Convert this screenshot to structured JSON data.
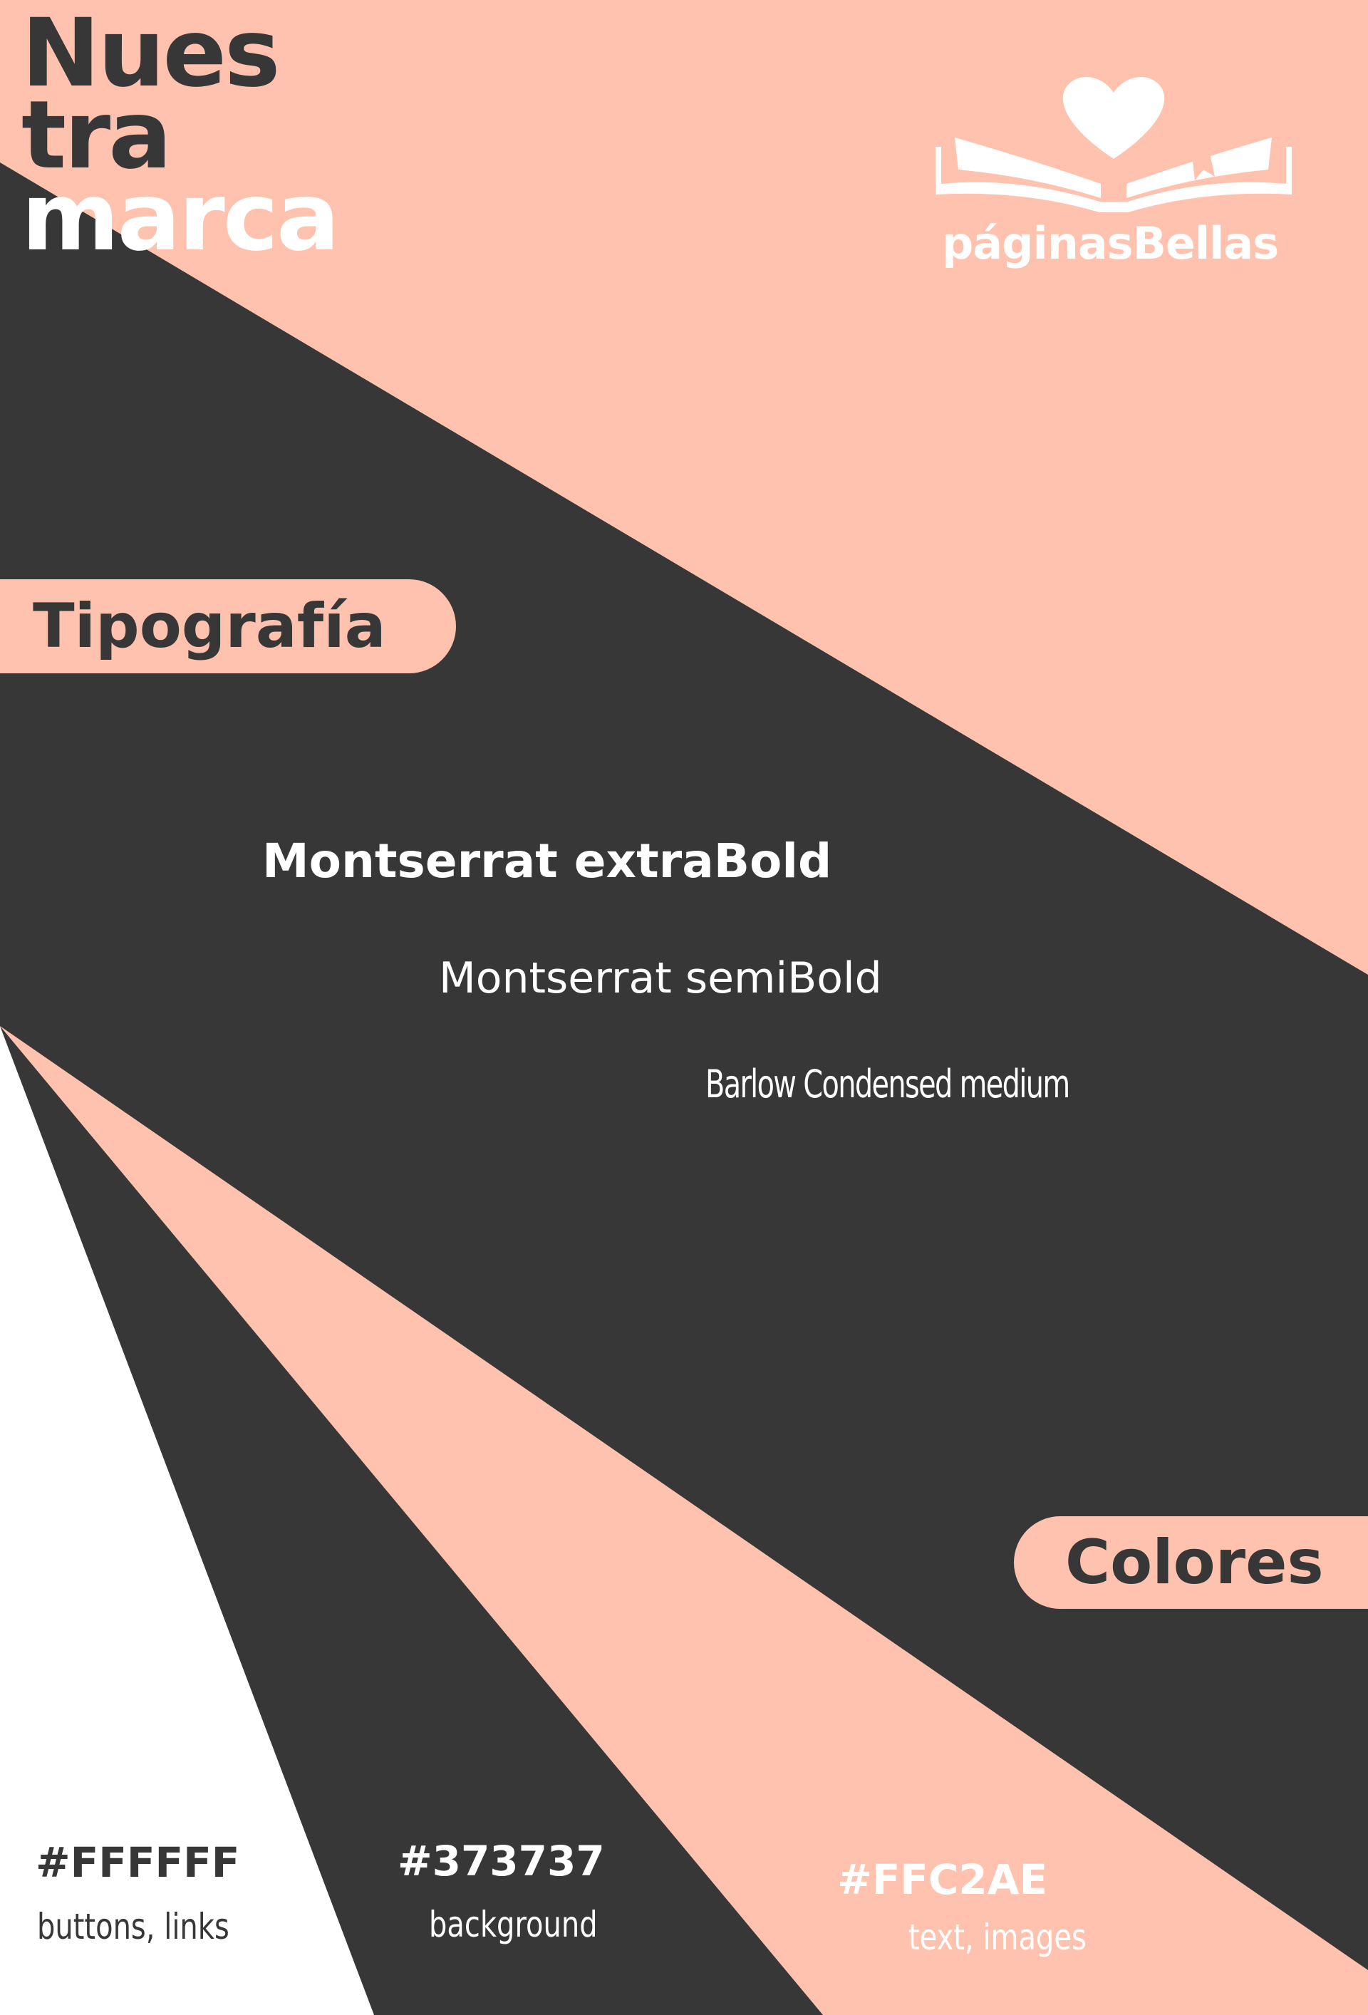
{
  "title": {
    "line1": "Nues",
    "line2": "tra",
    "line3": "marca"
  },
  "logo": {
    "icon": "heart-book-icon",
    "name": "páginasBellas"
  },
  "sections": {
    "typography": "Tipografía",
    "colors": "Colores"
  },
  "fonts": [
    "Montserrat extraBold",
    "Montserrat semiBold",
    "Barlow Condensed medium"
  ],
  "palette": [
    {
      "hex": "#FFFFFF",
      "usage": "buttons, links"
    },
    {
      "hex": "#373737",
      "usage": "background"
    },
    {
      "hex": "#FFC2AE",
      "usage": "text, images"
    }
  ]
}
